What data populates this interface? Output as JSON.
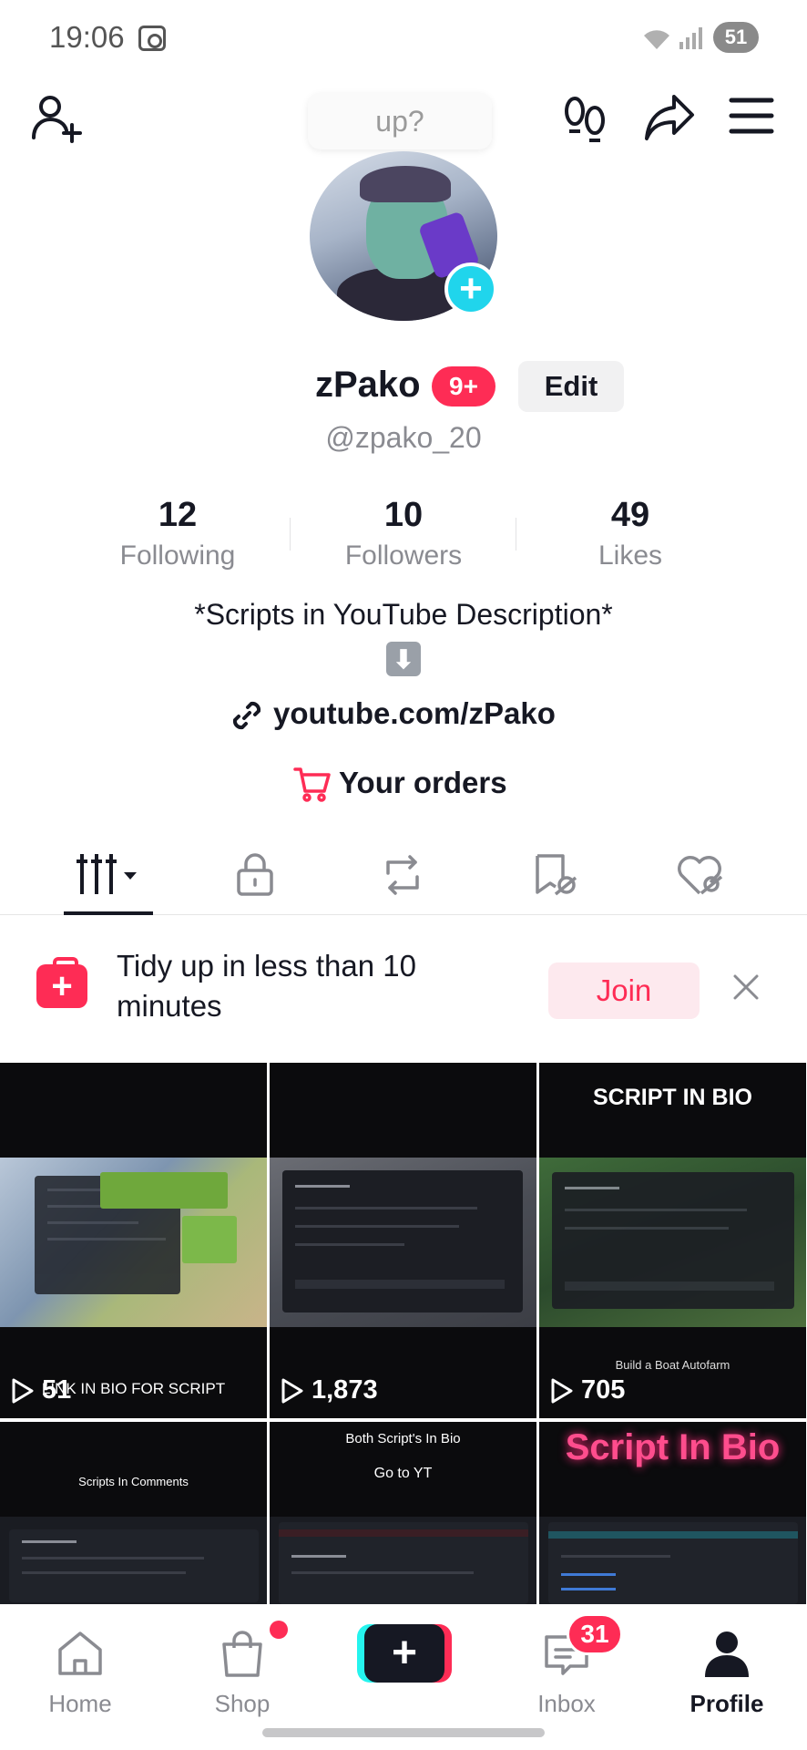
{
  "status_bar": {
    "time": "19:06",
    "battery": "51"
  },
  "tooltip": "up?",
  "profile": {
    "name": "zPako",
    "notif_badge": "9+",
    "edit_label": "Edit",
    "handle": "@zpako_20"
  },
  "stats": [
    {
      "value": "12",
      "label": "Following"
    },
    {
      "value": "10",
      "label": "Followers"
    },
    {
      "value": "49",
      "label": "Likes"
    }
  ],
  "bio": {
    "line1": "*Scripts in YouTube Description*",
    "arrow": "⬇",
    "link": "youtube.com/zPako",
    "orders": "Your orders"
  },
  "promo": {
    "text": "Tidy up in less than 10 minutes",
    "join": "Join",
    "close": "✕"
  },
  "videos": [
    {
      "top_caption": "",
      "bottom_caption": "LINK IN BIO FOR SCRIPT",
      "views": "51"
    },
    {
      "top_caption": "",
      "bottom_caption": "",
      "views": "1,873"
    },
    {
      "top_caption": "SCRIPT IN BIO",
      "bottom_caption": "Build a Boat Autofarm",
      "views": "705"
    },
    {
      "top_caption": "Scripts In Comments",
      "bottom_caption": "",
      "views": ""
    },
    {
      "top_caption": "Both Script's In Bio",
      "sub_caption": "Go to YT",
      "bottom_caption": "",
      "views": ""
    },
    {
      "top_caption": "Script In Bio",
      "bottom_caption": "",
      "views": ""
    }
  ],
  "nav": {
    "home": "Home",
    "shop": "Shop",
    "create": "+",
    "inbox": "Inbox",
    "inbox_badge": "31",
    "profile": "Profile"
  },
  "colors": {
    "accent": "#fe2c55",
    "cyan": "#25f4ee",
    "text": "#161823",
    "muted": "#8a8b91"
  }
}
